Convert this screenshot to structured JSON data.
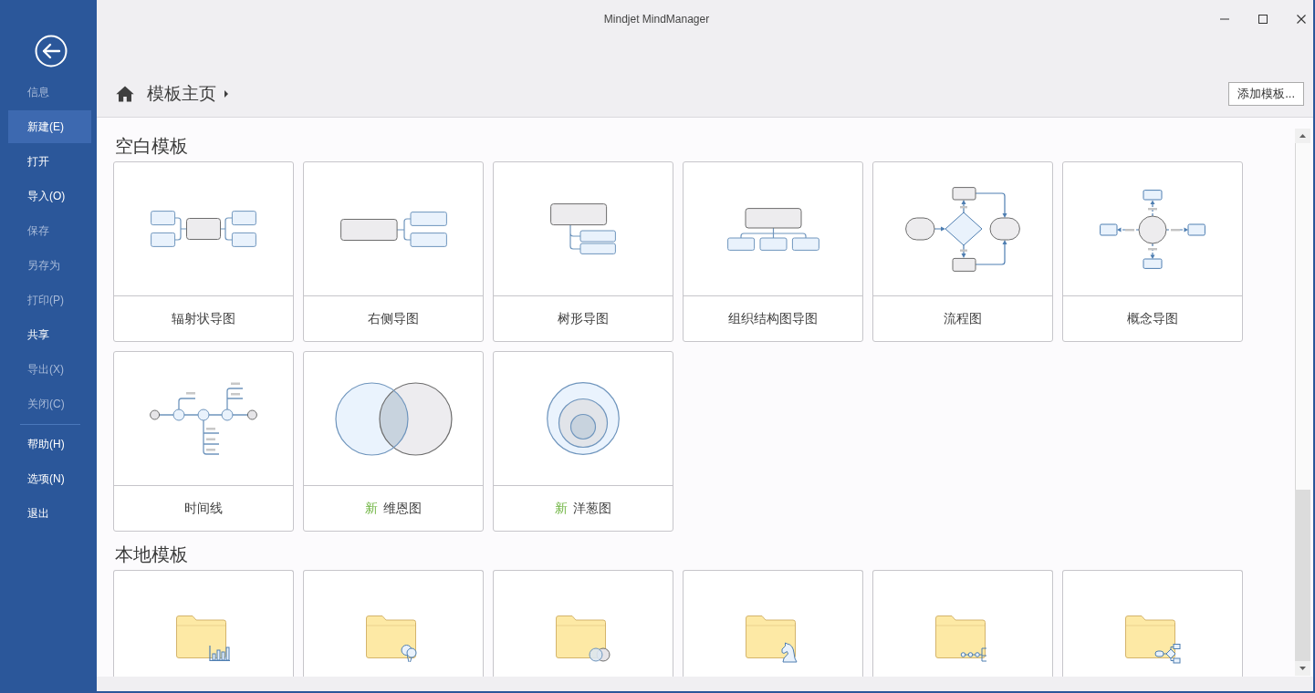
{
  "window": {
    "title": "Mindjet MindManager"
  },
  "sidebar": {
    "items": [
      {
        "label": "信息",
        "selected": false,
        "disabled": true
      },
      {
        "label": "新建(E)",
        "selected": true,
        "disabled": false
      },
      {
        "label": "打开",
        "selected": false,
        "disabled": false
      },
      {
        "label": "导入(O)",
        "selected": false,
        "disabled": false
      },
      {
        "label": "保存",
        "selected": false,
        "disabled": true
      },
      {
        "label": "另存为",
        "selected": false,
        "disabled": true
      },
      {
        "label": "打印(P)",
        "selected": false,
        "disabled": true
      },
      {
        "label": "共享",
        "selected": false,
        "disabled": false
      },
      {
        "label": "导出(X)",
        "selected": false,
        "disabled": true
      },
      {
        "label": "关闭(C)",
        "selected": false,
        "disabled": true
      }
    ],
    "bottom_items": [
      {
        "label": "帮助(H)",
        "selected": false,
        "disabled": false
      },
      {
        "label": "选项(N)",
        "selected": false,
        "disabled": false
      },
      {
        "label": "退出",
        "selected": false,
        "disabled": false
      }
    ]
  },
  "header": {
    "breadcrumb": "模板主页",
    "add_button": "添加模板..."
  },
  "blank_templates": {
    "heading": "空白模板",
    "items": [
      {
        "kind": "radial",
        "label": "辐射状导图"
      },
      {
        "kind": "right",
        "label": "右侧导图"
      },
      {
        "kind": "tree",
        "label": "树形导图"
      },
      {
        "kind": "org",
        "label": "组织结构图导图"
      },
      {
        "kind": "flow",
        "label": "流程图"
      },
      {
        "kind": "concept",
        "label": "概念导图"
      },
      {
        "kind": "timeline",
        "label": "时间线"
      },
      {
        "kind": "venn",
        "badge": "新",
        "label": "维恩图"
      },
      {
        "kind": "onion",
        "badge": "新",
        "label": "洋葱图"
      }
    ]
  },
  "local_templates": {
    "heading": "本地模板",
    "items": [
      {
        "kind": "chart"
      },
      {
        "kind": "balloons"
      },
      {
        "kind": "circles"
      },
      {
        "kind": "knight"
      },
      {
        "kind": "nodes"
      },
      {
        "kind": "flow"
      }
    ]
  }
}
